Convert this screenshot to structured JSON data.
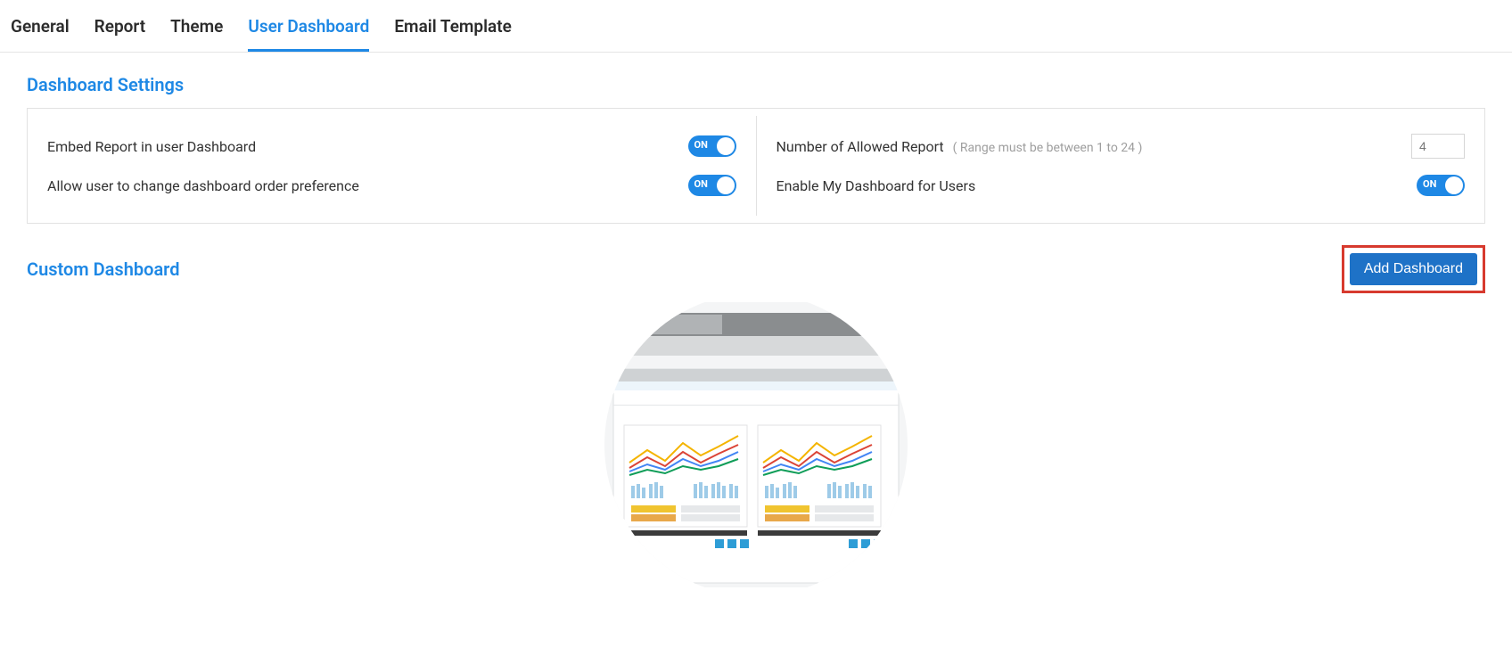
{
  "tabs": {
    "general": "General",
    "report": "Report",
    "theme": "Theme",
    "user_dashboard": "User Dashboard",
    "email_template": "Email Template"
  },
  "sections": {
    "dashboard_settings": "Dashboard Settings",
    "custom_dashboard": "Custom Dashboard"
  },
  "settings": {
    "embed_report_label": "Embed Report in user Dashboard",
    "embed_report_state": "ON",
    "allow_order_label": "Allow user to change dashboard order preference",
    "allow_order_state": "ON",
    "num_allowed_label": "Number of Allowed Report",
    "num_allowed_hint": "( Range must be between 1 to 24 )",
    "num_allowed_value": "4",
    "enable_my_dashboard_label": "Enable My Dashboard for Users",
    "enable_my_dashboard_state": "ON"
  },
  "buttons": {
    "add_dashboard": "Add Dashboard"
  }
}
